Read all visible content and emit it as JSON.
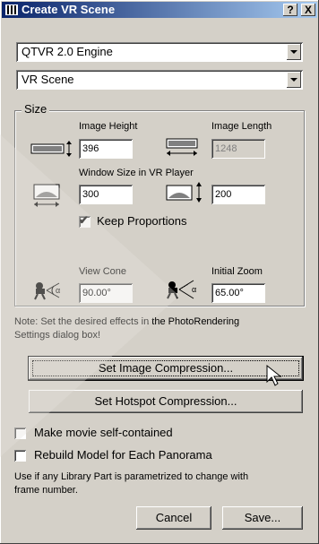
{
  "window": {
    "title": "Create VR Scene",
    "help_label": "?",
    "close_label": "X"
  },
  "engine_select": {
    "value": "QTVR 2.0 Engine"
  },
  "scene_select": {
    "value": "VR Scene"
  },
  "size_group": {
    "label": "Size",
    "image_height_label": "Image Height",
    "image_height_value": "396",
    "image_length_label": "Image Length",
    "image_length_value": "1248",
    "window_size_label": "Window Size in VR Player",
    "window_width_value": "300",
    "window_height_value": "200",
    "keep_proportions_label": "Keep Proportions",
    "keep_proportions_checked": true,
    "view_cone_label": "View Cone",
    "view_cone_value": "90.00°",
    "initial_zoom_label": "Initial Zoom",
    "initial_zoom_value": "65.00°"
  },
  "note_line1": "Note: Set the desired effects in the PhotoRendering",
  "note_line2": "Settings dialog box!",
  "set_image_compression_label": "Set Image Compression...",
  "set_hotspot_compression_label": "Set Hotspot Compression...",
  "make_movie_label": "Make movie self-contained",
  "rebuild_model_label": "Rebuild Model for Each Panorama",
  "library_note_line1": "Use if any Library Part is parametrized to change with",
  "library_note_line2": "frame number.",
  "cancel_label": "Cancel",
  "save_label": "Save..."
}
